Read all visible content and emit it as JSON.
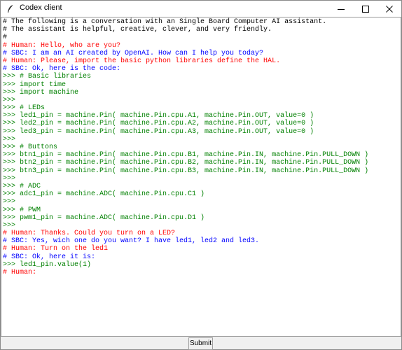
{
  "window": {
    "title": "Codex client"
  },
  "colors": {
    "comment": "#000000",
    "human": "#ff0000",
    "sbc": "#0000ff",
    "code": "#008000"
  },
  "console": {
    "lines": [
      {
        "kind": "comment",
        "text": "# The following is a conversation with an Single Board Computer AI assistant."
      },
      {
        "kind": "comment",
        "text": "# The assistant is helpful, creative, clever, and very friendly."
      },
      {
        "kind": "comment",
        "text": "#"
      },
      {
        "kind": "human",
        "text": "# Human: Hello, who are you?"
      },
      {
        "kind": "sbc",
        "text": "# SBC: I am an AI created by OpenAI. How can I help you today?"
      },
      {
        "kind": "human",
        "text": "# Human: Please, import the basic python libraries define the HAL."
      },
      {
        "kind": "sbc",
        "text": "# SBC: Ok, here is the code:"
      },
      {
        "kind": "code",
        "text": ">>> # Basic libraries"
      },
      {
        "kind": "code",
        "text": ">>> import time"
      },
      {
        "kind": "code",
        "text": ">>> import machine"
      },
      {
        "kind": "code",
        "text": ">>>"
      },
      {
        "kind": "code",
        "text": ">>> # LEDs"
      },
      {
        "kind": "code",
        "text": ">>> led1_pin = machine.Pin( machine.Pin.cpu.A1, machine.Pin.OUT, value=0 )"
      },
      {
        "kind": "code",
        "text": ">>> led2_pin = machine.Pin( machine.Pin.cpu.A2, machine.Pin.OUT, value=0 )"
      },
      {
        "kind": "code",
        "text": ">>> led3_pin = machine.Pin( machine.Pin.cpu.A3, machine.Pin.OUT, value=0 )"
      },
      {
        "kind": "code",
        "text": ">>>"
      },
      {
        "kind": "code",
        "text": ">>> # Buttons"
      },
      {
        "kind": "code",
        "text": ">>> btn1_pin = machine.Pin( machine.Pin.cpu.B1, machine.Pin.IN, machine.Pin.PULL_DOWN )"
      },
      {
        "kind": "code",
        "text": ">>> btn2_pin = machine.Pin( machine.Pin.cpu.B2, machine.Pin.IN, machine.Pin.PULL_DOWN )"
      },
      {
        "kind": "code",
        "text": ">>> btn3_pin = machine.Pin( machine.Pin.cpu.B3, machine.Pin.IN, machine.Pin.PULL_DOWN )"
      },
      {
        "kind": "code",
        "text": ">>>"
      },
      {
        "kind": "code",
        "text": ">>> # ADC"
      },
      {
        "kind": "code",
        "text": ">>> adc1_pin = machine.ADC( machine.Pin.cpu.C1 )"
      },
      {
        "kind": "code",
        "text": ">>>"
      },
      {
        "kind": "code",
        "text": ">>> # PWM"
      },
      {
        "kind": "code",
        "text": ">>> pwm1_pin = machine.ADC( machine.Pin.cpu.D1 )"
      },
      {
        "kind": "code",
        "text": ">>>"
      },
      {
        "kind": "human",
        "text": "# Human: Thanks. Could you turn on a LED?"
      },
      {
        "kind": "sbc",
        "text": "# SBC: Yes, wich one do you want? I have led1, led2 and led3."
      },
      {
        "kind": "human",
        "text": "# Human: Turn on the led1"
      },
      {
        "kind": "sbc",
        "text": "# SBC: Ok, here it is:"
      },
      {
        "kind": "code",
        "text": ">>> led1_pin.value(1)"
      },
      {
        "kind": "human",
        "text": "# Human:"
      }
    ]
  },
  "submit": {
    "label": "Submit"
  }
}
